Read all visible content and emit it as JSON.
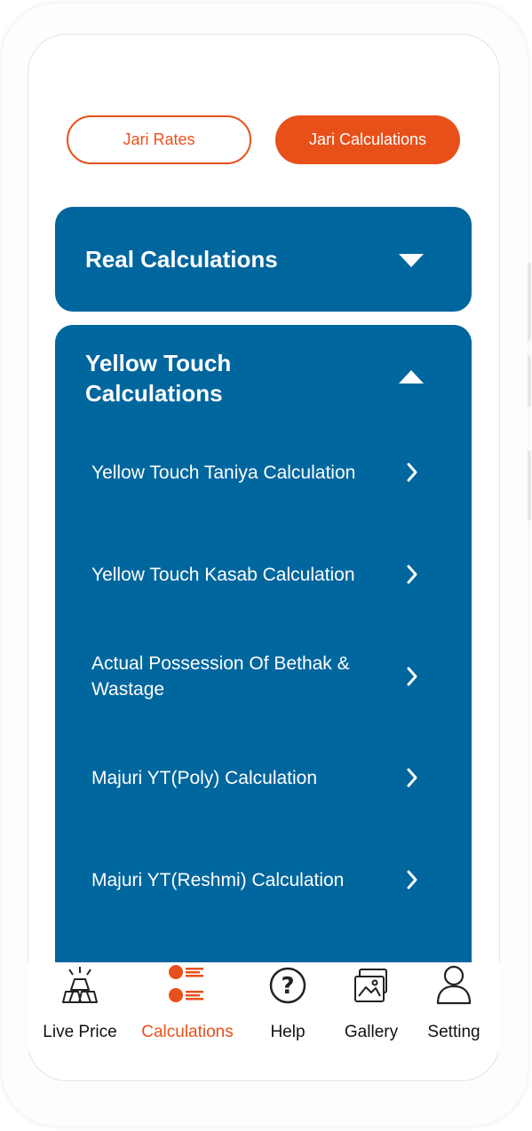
{
  "segments": {
    "rates_label": "Jari Rates",
    "calculations_label": "Jari Calculations"
  },
  "sections": {
    "real": {
      "title": "Real Calculations",
      "expanded": false
    },
    "yellow_touch": {
      "title": "Yellow Touch Calculations",
      "expanded": true,
      "items": [
        {
          "label": "Yellow Touch Taniya Calculation"
        },
        {
          "label": "Yellow Touch Kasab Calculation"
        },
        {
          "label": "Actual Possession Of Bethak & Wastage"
        },
        {
          "label": "Majuri YT(Poly) Calculation"
        },
        {
          "label": "Majuri YT(Reshmi) Calculation"
        }
      ]
    }
  },
  "tabs": [
    {
      "label": "Live Price",
      "icon": "gold-bars-icon",
      "active": false
    },
    {
      "label": "Calculations",
      "icon": "calculations-list-icon",
      "active": true
    },
    {
      "label": "Help",
      "icon": "help-icon",
      "active": false
    },
    {
      "label": "Gallery",
      "icon": "gallery-icon",
      "active": false
    },
    {
      "label": "Setting",
      "icon": "user-icon",
      "active": false
    }
  ],
  "colors": {
    "accent": "#e8501a",
    "card": "#00669e",
    "text_on_card": "#ffffff"
  }
}
